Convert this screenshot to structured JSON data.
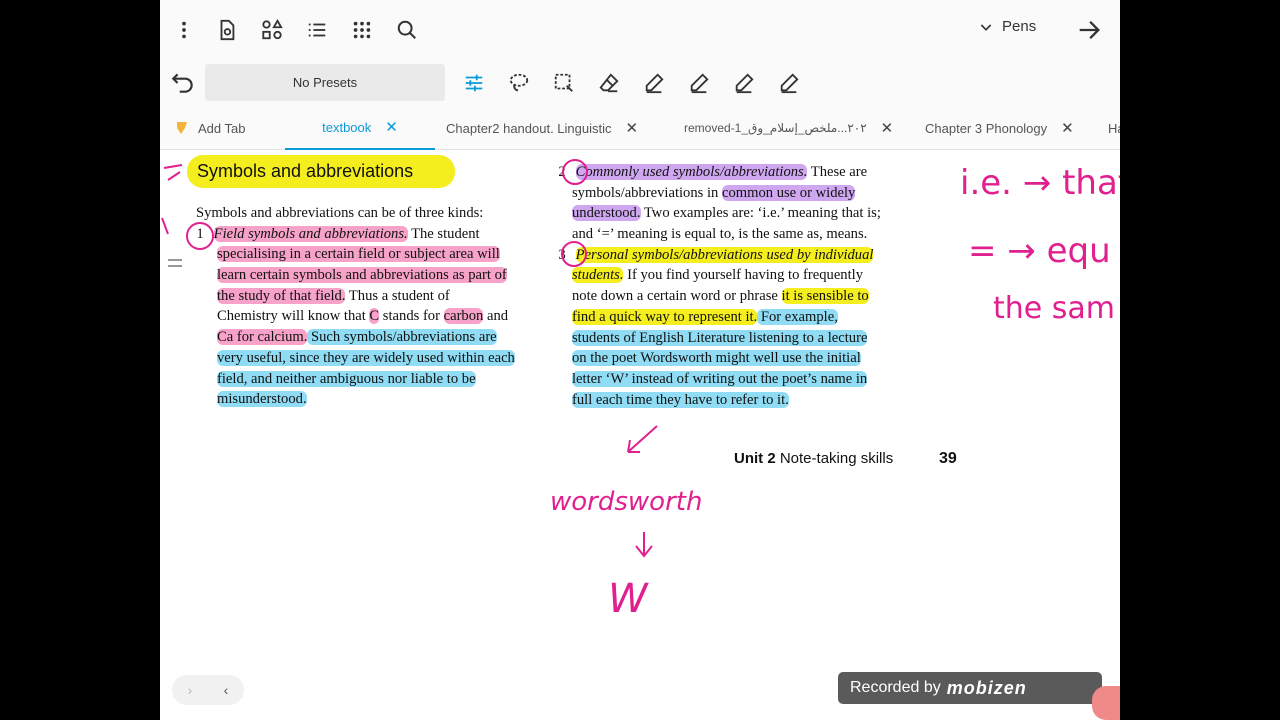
{
  "toolbar": {
    "pens_label": "Pens",
    "presets_label": "No Presets"
  },
  "icons": {
    "more": "more-vertical-icon",
    "page": "page-settings-icon",
    "shapes": "shapes-icon",
    "outline": "outline-list-icon",
    "grid": "grid-icon",
    "search": "search-icon",
    "forward": "arrow-right-icon",
    "undo": "undo-icon"
  },
  "tabs": [
    {
      "label": "Add Tab"
    },
    {
      "label": "textbook"
    },
    {
      "label": "Chapter2 handout. Linguistic"
    },
    {
      "label": "removed-1_٢٠٢...ملخص_إسلام_وق"
    },
    {
      "label": "Chapter 3 Phonology"
    },
    {
      "label": "Ha"
    }
  ],
  "doc": {
    "heading": "Symbols and abbreviations",
    "left": {
      "intro": "Symbols and abbreviations can be of three kinds:",
      "item_num": "1",
      "lines": [
        {
          "hl": "Field symbols and abbreviations.",
          "rest": " The student"
        },
        {
          "text": "specialising in a certain field or subject area will"
        },
        {
          "text": "learn certain symbols and abbreviations as part of"
        },
        {
          "hl": "the study of that field.",
          "rest": " Thus a student of"
        },
        {
          "pre": "Chemistry will know that ",
          "c": "C",
          "mid": " stands for ",
          "carbon": "carbon",
          "post": " and"
        },
        {
          "hl": "Ca for calcium.",
          "rest": " Such symbols/abbreviations are"
        },
        {
          "text": "very useful, since they are widely used within each"
        },
        {
          "text": "field, and neither ambiguous nor liable to be"
        },
        {
          "text": "misunderstood."
        }
      ]
    },
    "right": {
      "item2_num": "2",
      "item3_num": "3",
      "lines": [
        {
          "hl": "Commonly used symbols/abbreviations.",
          "rest": " These are"
        },
        {
          "pre": "symbols/abbreviations in ",
          "hl": "common use or widely"
        },
        {
          "hl": "understood.",
          "rest": " Two examples are: ‘i.e.’ meaning that is;"
        },
        {
          "text": "and ‘=’ meaning is equal to, is the same as, means."
        },
        {
          "hl": "Personal symbols/abbreviations used by individual"
        },
        {
          "hl": "students.",
          "rest": " If you find yourself having to frequently"
        },
        {
          "pre": "note down a certain word or phrase ",
          "hl": "it is sensible to"
        },
        {
          "hl": "find a quick way to represent it.",
          "rest": " For example,"
        },
        {
          "text": "students of English Literature listening to a lecture"
        },
        {
          "text": "on the poet Wordsworth might well use the initial"
        },
        {
          "text": "letter ‘W’ instead of writing out the poet’s name in"
        },
        {
          "text": "full each time they have to refer to it."
        }
      ]
    },
    "footer_unit": "Unit 2",
    "footer_title": "Note-taking skills",
    "page_number": "39",
    "handwriting": {
      "ie": "i.e. → that",
      "eq": "= → equ",
      "same": "the sam",
      "word": "wordsworth",
      "letter": "W"
    }
  },
  "overlay": {
    "recorded_by": "Recorded by",
    "brand": "mobizen"
  },
  "colors": {
    "accent": "#0b9bd6",
    "pink_highlight": "#f7a2c8",
    "blue_highlight": "#8fdcf4",
    "yellow_highlight": "#f5ee1f",
    "purple_highlight": "#cfa7f0",
    "ink": "#e0208f"
  }
}
